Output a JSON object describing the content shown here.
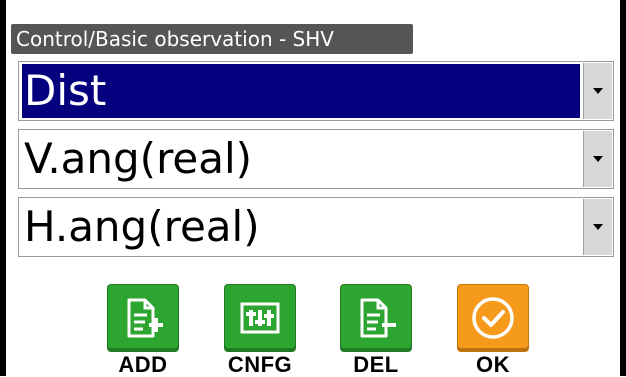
{
  "title": "Control/Basic observation - SHV",
  "fields": [
    {
      "value": "Dist",
      "selected": true
    },
    {
      "value": "V.ang(real)",
      "selected": false
    },
    {
      "value": "H.ang(real)",
      "selected": false
    }
  ],
  "buttons": {
    "add": {
      "label": "ADD",
      "icon": "document-add-icon"
    },
    "cnfg": {
      "label": "CNFG",
      "icon": "config-icon"
    },
    "del": {
      "label": "DEL",
      "icon": "document-delete-icon"
    },
    "ok": {
      "label": "OK",
      "icon": "checkmark-circle-icon"
    }
  },
  "colors": {
    "title_bg": "#555555",
    "selection_bg": "#05007e",
    "button_green": "#2da531",
    "button_orange": "#f59a1a"
  }
}
